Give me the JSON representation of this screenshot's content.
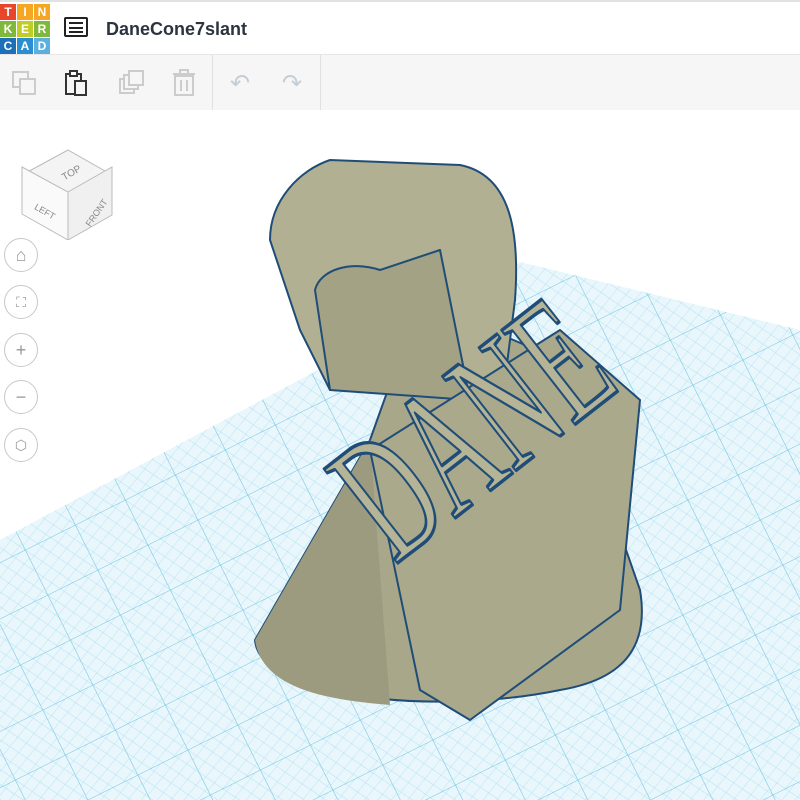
{
  "app": {
    "logo_letters": [
      "T",
      "I",
      "N",
      "K",
      "E",
      "R",
      "C",
      "A",
      "D"
    ],
    "logo_colors": [
      "#e8462b",
      "#f5a623",
      "#f5a623",
      "#7fb83a",
      "#c1cd23",
      "#7fb83a",
      "#1d6fb8",
      "#2a8fd0",
      "#5bb0e0"
    ]
  },
  "header": {
    "title": "DaneCone7slant",
    "menu_icon": "list-icon"
  },
  "toolbar": {
    "items": [
      {
        "name": "copy",
        "icon": "copy-icon",
        "enabled": false
      },
      {
        "name": "paste",
        "icon": "paste-icon",
        "enabled": true
      },
      {
        "name": "duplicate",
        "icon": "duplicate-icon",
        "enabled": false
      },
      {
        "name": "delete",
        "icon": "trash-icon",
        "enabled": false
      },
      {
        "name": "undo",
        "icon": "undo-icon",
        "enabled": false
      },
      {
        "name": "redo",
        "icon": "redo-icon",
        "enabled": false
      }
    ]
  },
  "viewcube": {
    "top": "TOP",
    "left": "LEFT",
    "front": "FRONT"
  },
  "nav": [
    "home-icon",
    "fit-icon",
    "zoom-in-icon",
    "zoom-out-icon",
    "perspective-icon"
  ],
  "model": {
    "text": "DANE",
    "color": "#a9a98a",
    "edge_color": "#1f4d78"
  },
  "grid": {
    "color": "#8fd3ea"
  }
}
